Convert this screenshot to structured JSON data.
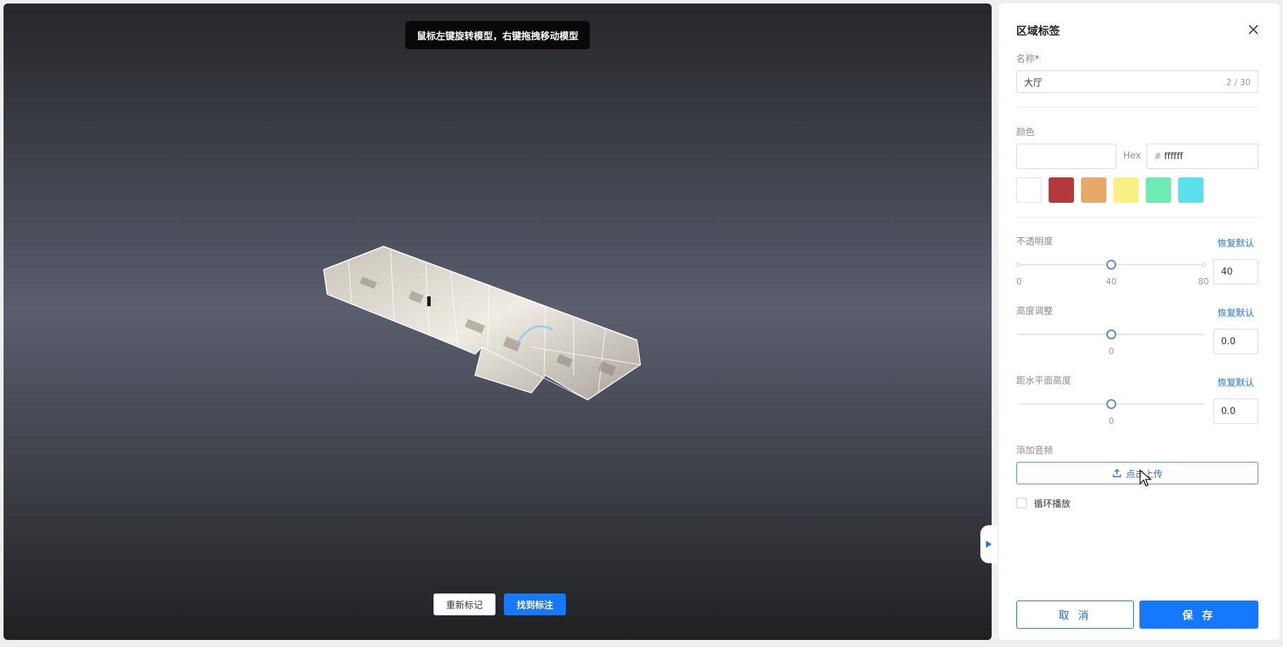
{
  "viewer": {
    "tip": "鼠标左键旋转模型，右键拖拽移动模型",
    "relabel_button": "重新标记",
    "find_button": "找到标注"
  },
  "panel": {
    "title": "区域标签",
    "name": {
      "label": "名称",
      "required_mark": "*",
      "value": "大厅",
      "counter": "2 / 30"
    },
    "color": {
      "label": "颜色",
      "hex_label": "Hex",
      "hash": "#",
      "hex_value": "ffffff",
      "swatches": [
        "#ffffff",
        "#b23a3a",
        "#eaa76a",
        "#fbf084",
        "#6eeab3",
        "#5be1ee"
      ]
    },
    "opacity": {
      "label": "不透明度",
      "reset": "恢复默认",
      "min": "0",
      "current": "40",
      "max": "80",
      "value": "40"
    },
    "height": {
      "label": "高度调整",
      "reset": "恢复默认",
      "current": "0",
      "value": "0.0"
    },
    "ground_height": {
      "label": "距水平面高度",
      "reset": "恢复默认",
      "current": "0",
      "value": "0.0"
    },
    "audio": {
      "label": "添加音频",
      "upload": "点击上传"
    },
    "loop": {
      "label": "循环播放",
      "checked": false
    },
    "cancel": "取 消",
    "save": "保 存"
  }
}
